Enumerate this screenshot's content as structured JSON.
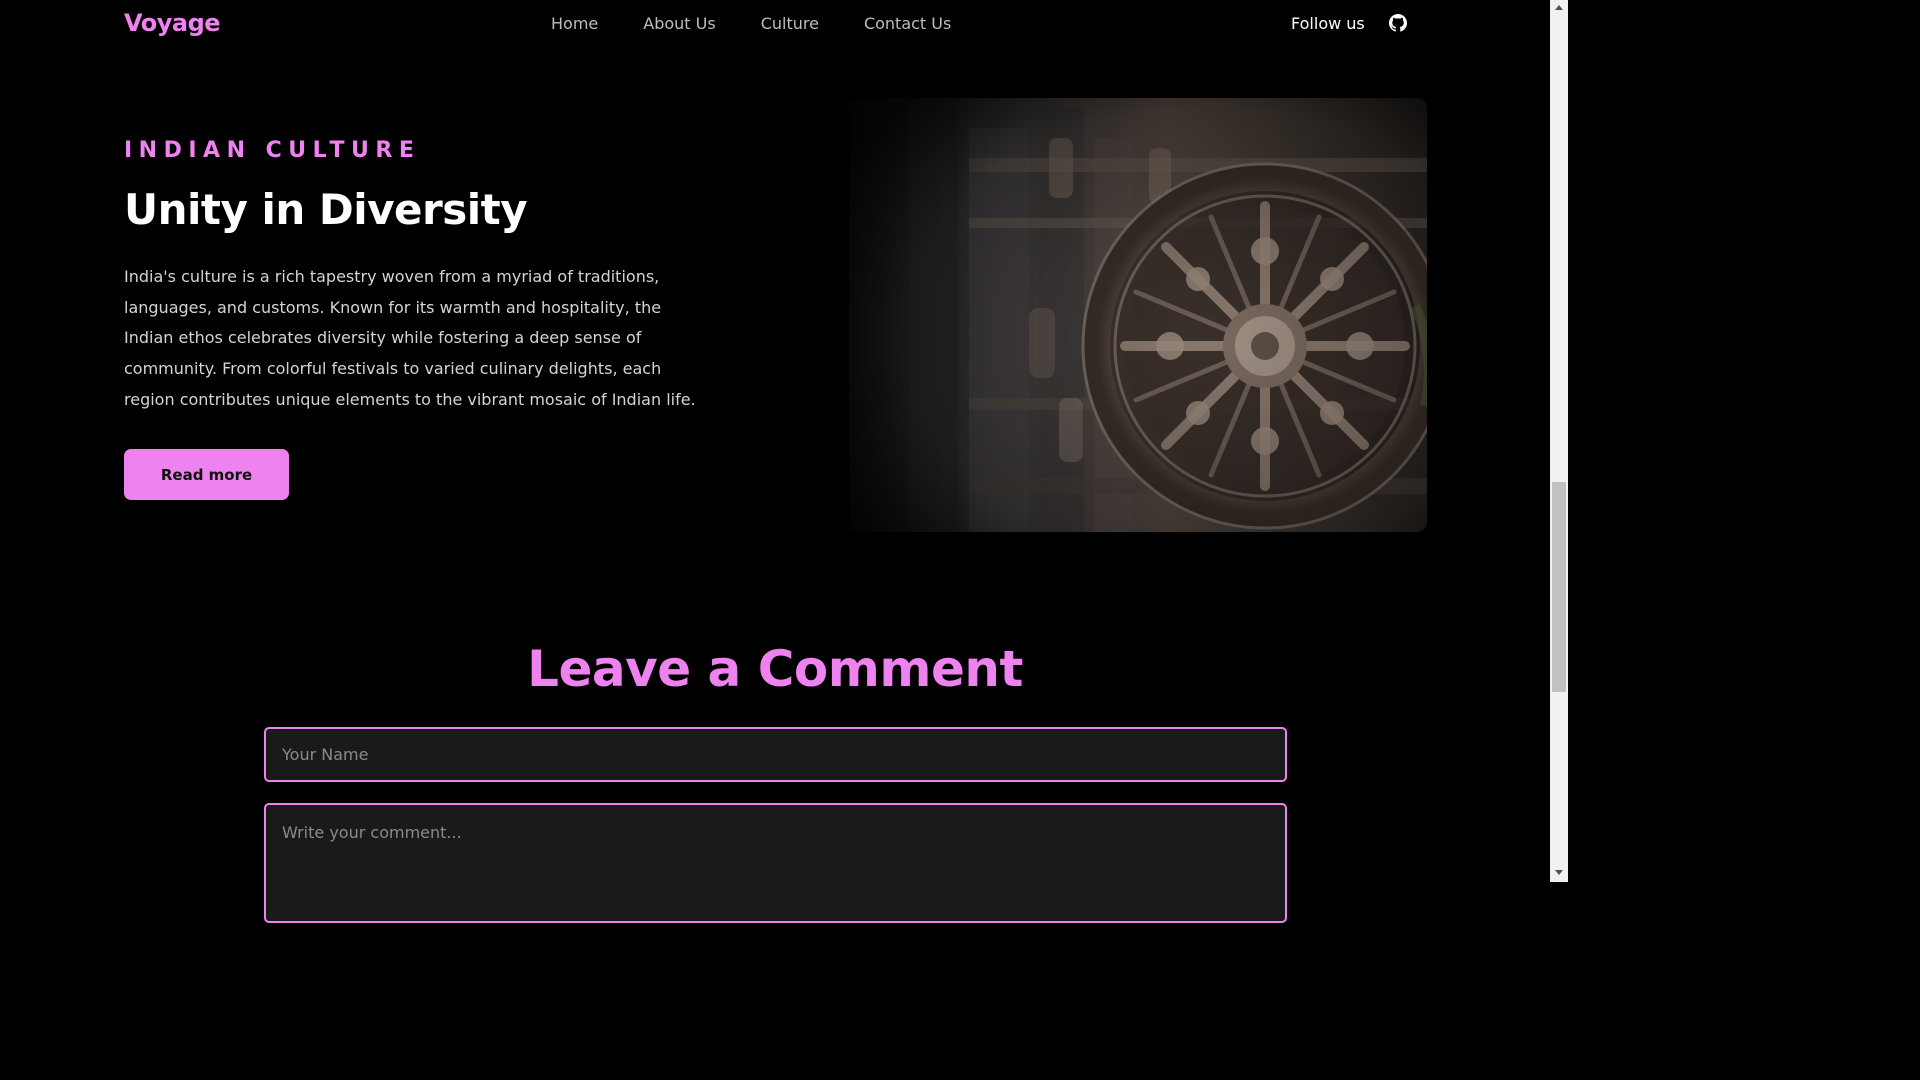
{
  "navbar": {
    "brand": "Voyage",
    "links": [
      "Home",
      "About Us",
      "Culture",
      "Contact Us"
    ],
    "follow_label": "Follow us",
    "github_icon": "github-icon"
  },
  "hero": {
    "eyebrow": "INDIAN CULTURE",
    "title": "Unity in Diversity",
    "text": "India's culture is a rich tapestry woven from a myriad of traditions, languages, and customs. Known for its warmth and hospitality, the Indian ethos celebrates diversity while fostering a deep sense of community. From colorful festivals to varied culinary delights, each region contributes unique elements to the vibrant mosaic of Indian life.",
    "button_label": "Read more",
    "image_subject": "konark-sun-temple-stone-wheel"
  },
  "comment": {
    "title": "Leave a Comment",
    "name_placeholder": "Your Name",
    "comment_placeholder": "Write your comment..."
  },
  "colors": {
    "accent": "#ee82ee",
    "background": "#000000",
    "input_bg": "#1a1a1a",
    "body_text": "#d4d4d4",
    "nav_text": "#bdbdbd"
  }
}
